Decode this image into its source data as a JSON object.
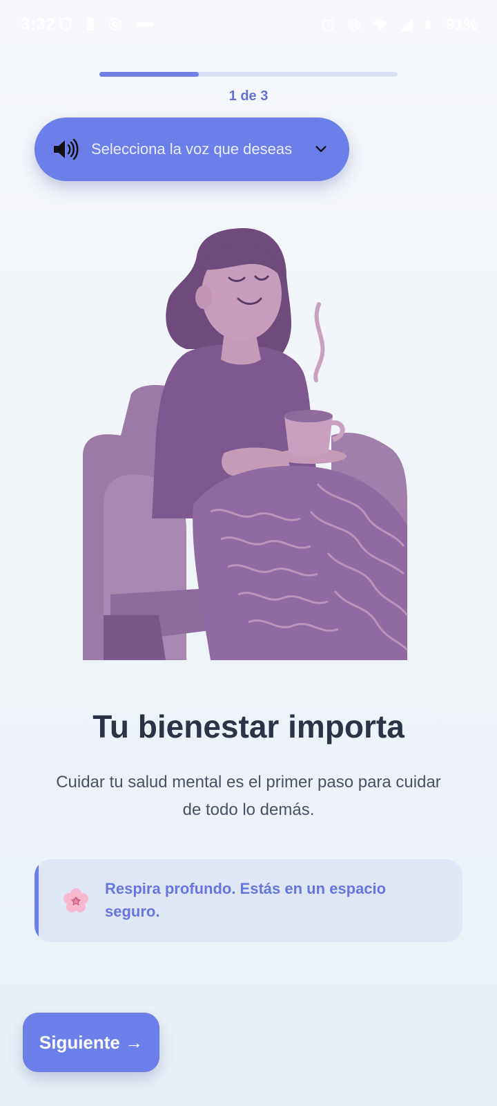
{
  "status_bar": {
    "time": "3:32",
    "battery": "91%",
    "icons_left": [
      "shield-icon",
      "battery-saver-icon",
      "at-icon",
      "sim-icon"
    ],
    "icons_right": [
      "alarm-icon",
      "vibrate-off-icon",
      "wifi-icon",
      "signal-icon",
      "battery-icon"
    ]
  },
  "progress": {
    "label": "1 de 3",
    "fraction": 0.333
  },
  "voice_selector": {
    "label": "Selecciona la voz que deseas",
    "icon": "speaker-icon"
  },
  "main": {
    "title": "Tu bienestar importa",
    "description": "Cuidar tu salud mental es el primer paso para cuidar de todo lo demás."
  },
  "tip": {
    "icon": "flower-icon",
    "text": "Respira profundo. Estás en un espacio seguro."
  },
  "next_button": {
    "label": "Siguiente →"
  },
  "colors": {
    "accent": "#6b7fe8",
    "heading": "#2b3347",
    "illustration": "#8c6597"
  }
}
